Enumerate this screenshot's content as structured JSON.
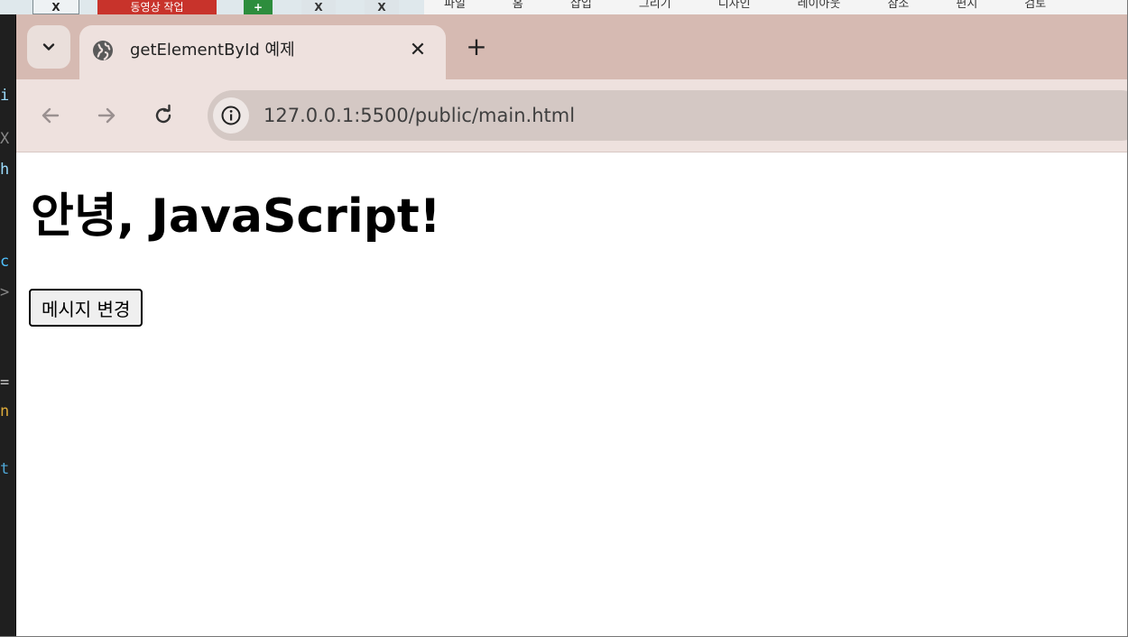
{
  "background": {
    "taskbar_buttons": {
      "close_glyph": "X",
      "red_tab_label": "동영상 작업",
      "green_tab_glyph": "+",
      "dark_tab_glyph_1": "X",
      "dark_tab_glyph_2": "X"
    },
    "ribbon_items": [
      "파일",
      "홈",
      "삽입",
      "그리기",
      "디자인",
      "레이아웃",
      "참조",
      "편지",
      "검토"
    ],
    "editor_strip_chars": [
      "i",
      "X",
      "h",
      "c",
      ">",
      "=",
      "n",
      "t"
    ]
  },
  "browser": {
    "tab_search_icon": "chevron-down-icon",
    "active_tab": {
      "favicon": "globe-icon",
      "title": "getElementById 예제",
      "close_glyph": "✕"
    },
    "new_tab_glyph": "+",
    "toolbar": {
      "back_icon": "arrow-left-icon",
      "forward_icon": "arrow-right-icon",
      "reload_icon": "reload-icon",
      "site_info_icon": "info-icon",
      "url": "127.0.0.1:5500/public/main.html"
    },
    "colors": {
      "tabstrip_bg": "#d6bab2",
      "toolbar_bg": "#eee1de",
      "omnibox_bg": "#d4c8c4",
      "page_bg": "#ffffff"
    }
  },
  "page": {
    "heading": "안녕, JavaScript!",
    "button_label": "메시지 변경"
  }
}
